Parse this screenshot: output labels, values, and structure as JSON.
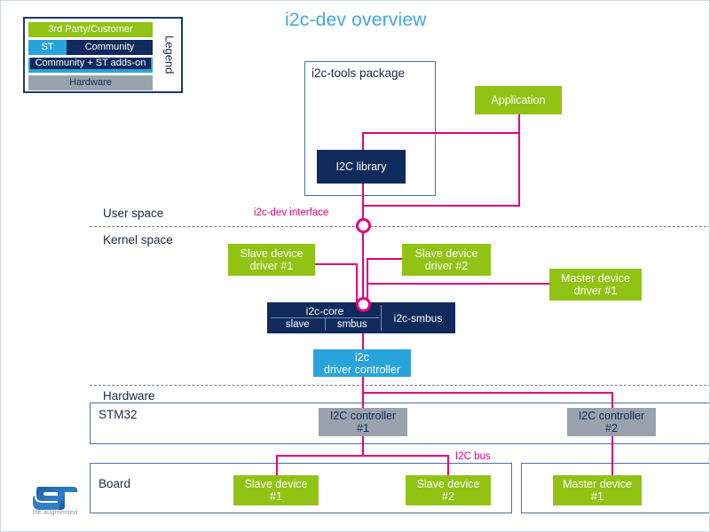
{
  "slide": {
    "title": "i2c-dev overview"
  },
  "legend": {
    "label": "Legend",
    "rows": [
      {
        "text": "3rd Party/Customer",
        "color": "#91c314"
      },
      {
        "left": "ST",
        "right": "Community",
        "left_color": "#29a3dc",
        "right_color": "#102a5c"
      },
      {
        "text": "Community + ST adds-on",
        "border_color": "#29a3dc",
        "fill_color": "#102a5c"
      },
      {
        "text": "Hardware",
        "color": "#9aa3ad"
      }
    ]
  },
  "sections": {
    "user_space": "User space",
    "kernel_space": "Kernel space",
    "hardware": "Hardware"
  },
  "containers": {
    "i2c_tools": "i2c-tools package",
    "stm32": "STM32",
    "board": "Board"
  },
  "blocks": {
    "application": "Application",
    "i2c_library": "I2C library",
    "slave_driver_1": "Slave device\ndriver #1",
    "slave_driver_2": "Slave device\ndriver #2",
    "master_driver_1": "Master device\ndriver #1",
    "i2c_core": "i2c-core",
    "i2c_core_slave": "slave",
    "i2c_core_smbus": "smbus",
    "i2c_smbus": "i2c-smbus",
    "i2c_driver_controller": "i2c\ndriver controller",
    "i2c_controller_1": "I2C controller\n#1",
    "i2c_controller_2": "I2C controller\n#2",
    "slave_device_1": "Slave device\n#1",
    "slave_device_2": "Slave device\n#2",
    "master_device_1": "Master device\n#1"
  },
  "wire_labels": {
    "i2c_dev_interface": "i2c-dev interface",
    "i2c_bus": "I2C bus"
  },
  "brand": {
    "tagline": "life.augmented"
  },
  "colors": {
    "accent_title": "#41a8e0",
    "green": "#91c314",
    "navy": "#102a5c",
    "blue": "#29a3dc",
    "grey": "#9aa3ad",
    "wire": "#e2007a",
    "outline": "#4a6fa5"
  }
}
